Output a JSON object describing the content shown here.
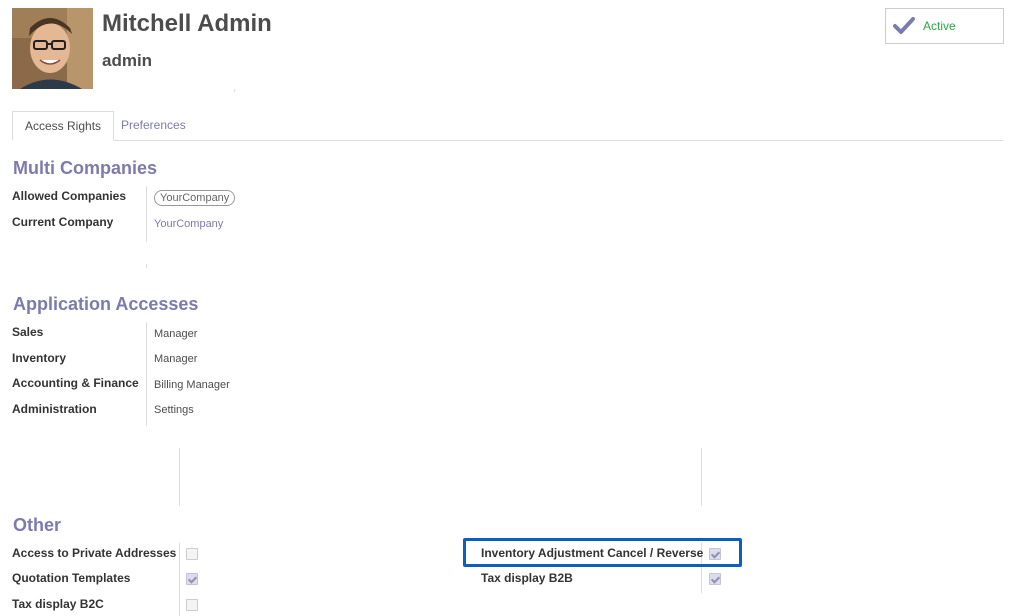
{
  "user": {
    "name": "Mitchell Admin",
    "login": "admin"
  },
  "status": {
    "label": "Active",
    "color": "#28a745",
    "icon": "check-icon"
  },
  "tabs": [
    {
      "label": "Access Rights",
      "active": true
    },
    {
      "label": "Preferences",
      "active": false
    }
  ],
  "multi_companies": {
    "title": "Multi Companies",
    "allowed_label": "Allowed Companies",
    "allowed_tag": "YourCompany",
    "current_label": "Current Company",
    "current_value": "YourCompany"
  },
  "app_access": {
    "title": "Application Accesses",
    "rows": [
      {
        "label": "Sales",
        "value": "Manager"
      },
      {
        "label": "Inventory",
        "value": "Manager"
      },
      {
        "label": "Accounting & Finance",
        "value": "Billing Manager"
      },
      {
        "label": "Administration",
        "value": "Settings"
      }
    ]
  },
  "other": {
    "title": "Other",
    "left": [
      {
        "label": "Access to Private Addresses",
        "checked": false
      },
      {
        "label": "Quotation Templates",
        "checked": true
      },
      {
        "label": "Tax display B2C",
        "checked": false
      }
    ],
    "right": [
      {
        "label": "Inventory Adjustment Cancel / Reverse",
        "checked": true
      },
      {
        "label": "Tax display B2B",
        "checked": true
      }
    ]
  },
  "colors": {
    "accent": "#7c7bad",
    "highlight": "#0d5fbf"
  }
}
